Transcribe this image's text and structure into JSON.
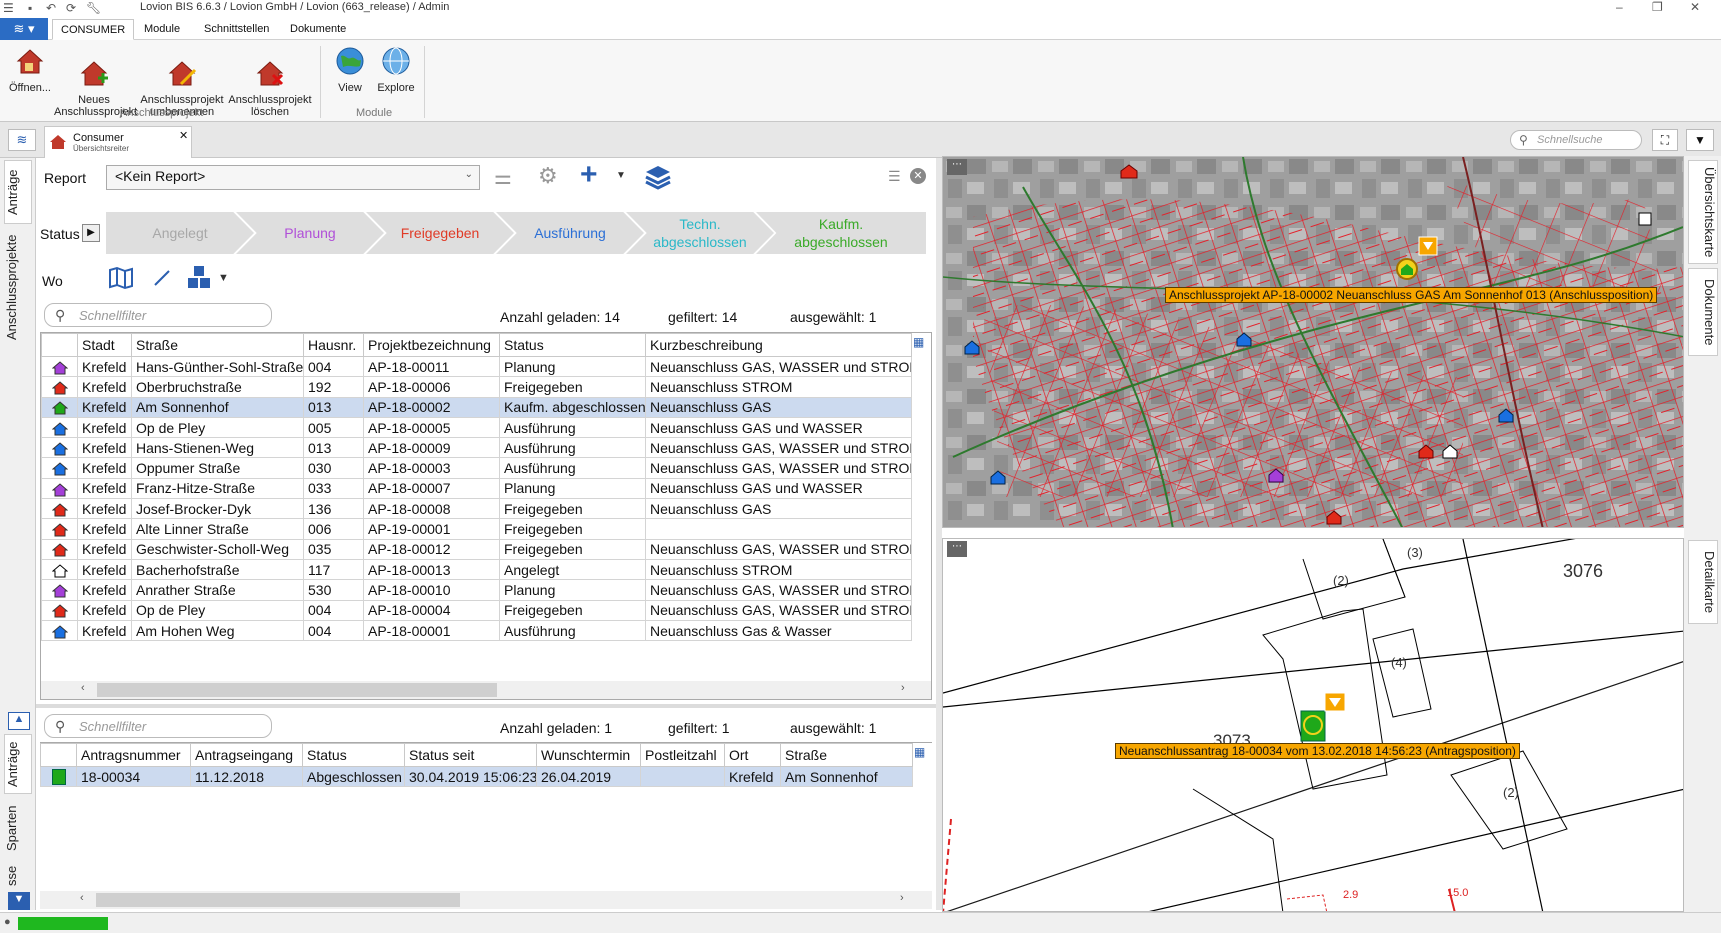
{
  "window": {
    "title": "Lovion BIS 6.6.3 / Lovion GmbH / Lovion (663_release) / Admin"
  },
  "menu": {
    "tabs": [
      {
        "label": "CONSUMER",
        "active": true
      },
      {
        "label": "Module"
      },
      {
        "label": "Schnittstellen"
      },
      {
        "label": "Dokumente"
      }
    ]
  },
  "ribbon": {
    "groups": [
      {
        "label": "Anschlussprojekt",
        "buttons": [
          {
            "label": "Öffnen...",
            "icon": "house-open-icon"
          },
          {
            "label": "Neues\nAnschlussprojekt",
            "icon": "house-add-icon"
          },
          {
            "label": "Anschlussprojekt\numbenennen",
            "icon": "house-rename-icon"
          },
          {
            "label": "Anschlussprojekt\nlöschen",
            "icon": "house-delete-icon"
          }
        ]
      },
      {
        "label": "Module",
        "buttons": [
          {
            "label": "View",
            "icon": "globe-icon"
          },
          {
            "label": "Explore",
            "icon": "globe-explore-icon"
          }
        ]
      }
    ]
  },
  "doc_tab": {
    "title": "Consumer",
    "subtitle": "Übersichtsreiter"
  },
  "quick_search": {
    "placeholder": "Schnellsuche"
  },
  "left_tabs": {
    "upper": [
      "Anträge",
      "Anschlussprojekte"
    ],
    "lower": [
      "Anträge",
      "Sparten",
      "sse"
    ]
  },
  "right_tabs": {
    "upper": [
      "Übersichtskarte",
      "Dokumente"
    ],
    "lower": [
      "Detailkarte"
    ]
  },
  "report": {
    "label": "Report",
    "value": "<Kein Report>"
  },
  "status": {
    "label": "Status",
    "steps": [
      {
        "label": "Angelegt",
        "color": "#a8a8a8"
      },
      {
        "label": "Planung",
        "color": "#b04fd8"
      },
      {
        "label": "Freigegeben",
        "color": "#e03a26"
      },
      {
        "label": "Ausführung",
        "color": "#2b6fd6"
      },
      {
        "label": "Techn.\nabgeschlossen",
        "color": "#2ab8c8"
      },
      {
        "label": "Kaufm.\nabgeschlossen",
        "color": "#3aaa28"
      }
    ]
  },
  "wo": {
    "label": "Wo"
  },
  "projects": {
    "filter_placeholder": "Schnellfilter",
    "counts": {
      "loaded": "Anzahl geladen: 14",
      "filtered": "gefiltert: 14",
      "selected": "ausgewählt: 1"
    },
    "columns": [
      "Stadt",
      "Straße",
      "Hausnr.",
      "Projektbezeichnung",
      "Status",
      "Kurzbeschreibung"
    ],
    "rows": [
      {
        "icon": "#a43fd8",
        "stadt": "Krefeld",
        "strasse": "Hans-Günther-Sohl-Straße",
        "hausnr": "004",
        "projekt": "AP-18-00011",
        "status": "Planung",
        "kurz": "Neuanschluss GAS, WASSER und STROM"
      },
      {
        "icon": "#e02a1a",
        "stadt": "Krefeld",
        "strasse": "Oberbruchstraße",
        "hausnr": "192",
        "projekt": "AP-18-00006",
        "status": "Freigegeben",
        "kurz": "Neuanschluss STROM"
      },
      {
        "icon": "#1fa81a",
        "stadt": "Krefeld",
        "strasse": "Am Sonnenhof",
        "hausnr": "013",
        "projekt": "AP-18-00002",
        "status": "Kaufm. abgeschlossen",
        "kurz": "Neuanschluss GAS",
        "selected": true
      },
      {
        "icon": "#1a6fe0",
        "stadt": "Krefeld",
        "strasse": "Op de Pley",
        "hausnr": "005",
        "projekt": "AP-18-00005",
        "status": "Ausführung",
        "kurz": "Neuanschluss GAS und WASSER"
      },
      {
        "icon": "#1a6fe0",
        "stadt": "Krefeld",
        "strasse": "Hans-Stienen-Weg",
        "hausnr": "013",
        "projekt": "AP-18-00009",
        "status": "Ausführung",
        "kurz": "Neuanschluss GAS, WASSER und STROM"
      },
      {
        "icon": "#1a6fe0",
        "stadt": "Krefeld",
        "strasse": "Oppumer Straße",
        "hausnr": "030",
        "projekt": "AP-18-00003",
        "status": "Ausführung",
        "kurz": "Neuanschluss GAS, WASSER und STROM"
      },
      {
        "icon": "#a43fd8",
        "stadt": "Krefeld",
        "strasse": "Franz-Hitze-Straße",
        "hausnr": "033",
        "projekt": "AP-18-00007",
        "status": "Planung",
        "kurz": "Neuanschluss GAS und WASSER"
      },
      {
        "icon": "#e02a1a",
        "stadt": "Krefeld",
        "strasse": "Josef-Brocker-Dyk",
        "hausnr": "136",
        "projekt": "AP-18-00008",
        "status": "Freigegeben",
        "kurz": "Neuanschluss GAS"
      },
      {
        "icon": "#e02a1a",
        "stadt": "Krefeld",
        "strasse": "Alte Linner Straße",
        "hausnr": "006",
        "projekt": "AP-19-00001",
        "status": "Freigegeben",
        "kurz": ""
      },
      {
        "icon": "#e02a1a",
        "stadt": "Krefeld",
        "strasse": "Geschwister-Scholl-Weg",
        "hausnr": "035",
        "projekt": "AP-18-00012",
        "status": "Freigegeben",
        "kurz": "Neuanschluss GAS, WASSER und STROM"
      },
      {
        "icon": "#ffffff",
        "stadt": "Krefeld",
        "strasse": "Bacherhofstraße",
        "hausnr": "117",
        "projekt": "AP-18-00013",
        "status": "Angelegt",
        "kurz": "Neuanschluss STROM"
      },
      {
        "icon": "#a43fd8",
        "stadt": "Krefeld",
        "strasse": "Anrather Straße",
        "hausnr": "530",
        "projekt": "AP-18-00010",
        "status": "Planung",
        "kurz": "Neuanschluss GAS, WASSER und STROM"
      },
      {
        "icon": "#e02a1a",
        "stadt": "Krefeld",
        "strasse": "Op de Pley",
        "hausnr": "004",
        "projekt": "AP-18-00004",
        "status": "Freigegeben",
        "kurz": "Neuanschluss GAS, WASSER und STROM"
      },
      {
        "icon": "#1a6fe0",
        "stadt": "Krefeld",
        "strasse": "Am Hohen Weg",
        "hausnr": "004",
        "projekt": "AP-18-00001",
        "status": "Ausführung",
        "kurz": "Neuanschluss Gas & Wasser"
      }
    ]
  },
  "antraege": {
    "filter_placeholder": "Schnellfilter",
    "counts": {
      "loaded": "Anzahl geladen: 1",
      "filtered": "gefiltert: 1",
      "selected": "ausgewählt: 1"
    },
    "columns": [
      "Antragsnummer",
      "Antragseingang",
      "Status",
      "Status seit",
      "Wunschtermin",
      "Postleitzahl",
      "Ort",
      "Straße"
    ],
    "rows": [
      {
        "icon": "#1fa81a",
        "nummer": "18-00034",
        "eingang": "11.12.2018",
        "status": "Abgeschlossen",
        "seit": "30.04.2019 15:06:23",
        "wunsch": "26.04.2019",
        "plz": "",
        "ort": "Krefeld",
        "strasse": "Am Sonnenhof",
        "selected": true
      }
    ]
  },
  "maps": {
    "overview_label": "Anschlussprojekt AP-18-00002 Neuanschluss GAS Am Sonnenhof 013 (Anschlussposition)",
    "detail_label": "Neuanschlussantrag 18-00034 vom 13.02.2018 14:56:23 (Antragsposition)",
    "detail_numbers": [
      "(3)",
      "(2)",
      "3076",
      "(4)",
      "3073",
      "(2)",
      "2.9",
      "15.0"
    ]
  }
}
